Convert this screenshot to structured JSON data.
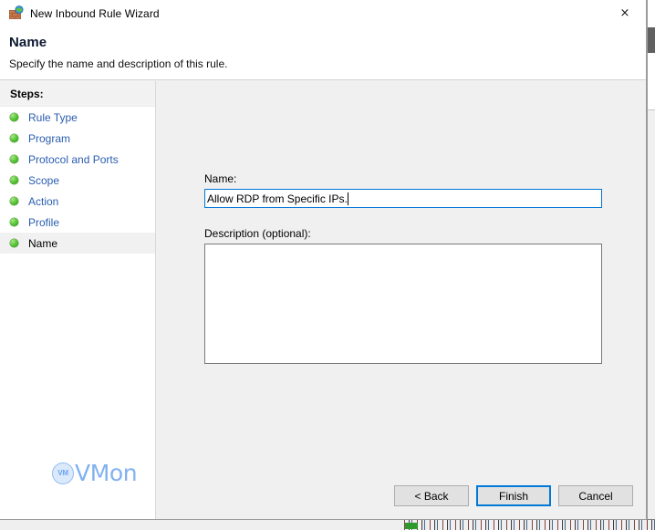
{
  "window": {
    "title": "New Inbound Rule Wizard",
    "icon": "firewall-brick-globe-icon",
    "close_label": "×"
  },
  "header": {
    "title": "Name",
    "subtitle": "Specify the name and description of this rule."
  },
  "sidebar": {
    "heading": "Steps:",
    "items": [
      {
        "label": "Rule Type",
        "current": false
      },
      {
        "label": "Program",
        "current": false
      },
      {
        "label": "Protocol and Ports",
        "current": false
      },
      {
        "label": "Scope",
        "current": false
      },
      {
        "label": "Action",
        "current": false
      },
      {
        "label": "Profile",
        "current": false
      },
      {
        "label": "Name",
        "current": true
      }
    ],
    "watermark": {
      "badge": "VM",
      "text": "VMon"
    }
  },
  "form": {
    "name_label": "Name:",
    "name_value": "Allow RDP from Specific IPs.",
    "name_placeholder": "",
    "description_label": "Description (optional):",
    "description_value": "",
    "description_placeholder": ""
  },
  "footer": {
    "back_label": "< Back",
    "finish_label": "Finish",
    "cancel_label": "Cancel"
  },
  "colors": {
    "accent": "#0078D7",
    "link": "#2A5DB0",
    "step_bullet": "#5FC83C",
    "watermark": "#82B1F0",
    "window_bg": "#F0F0F0"
  }
}
